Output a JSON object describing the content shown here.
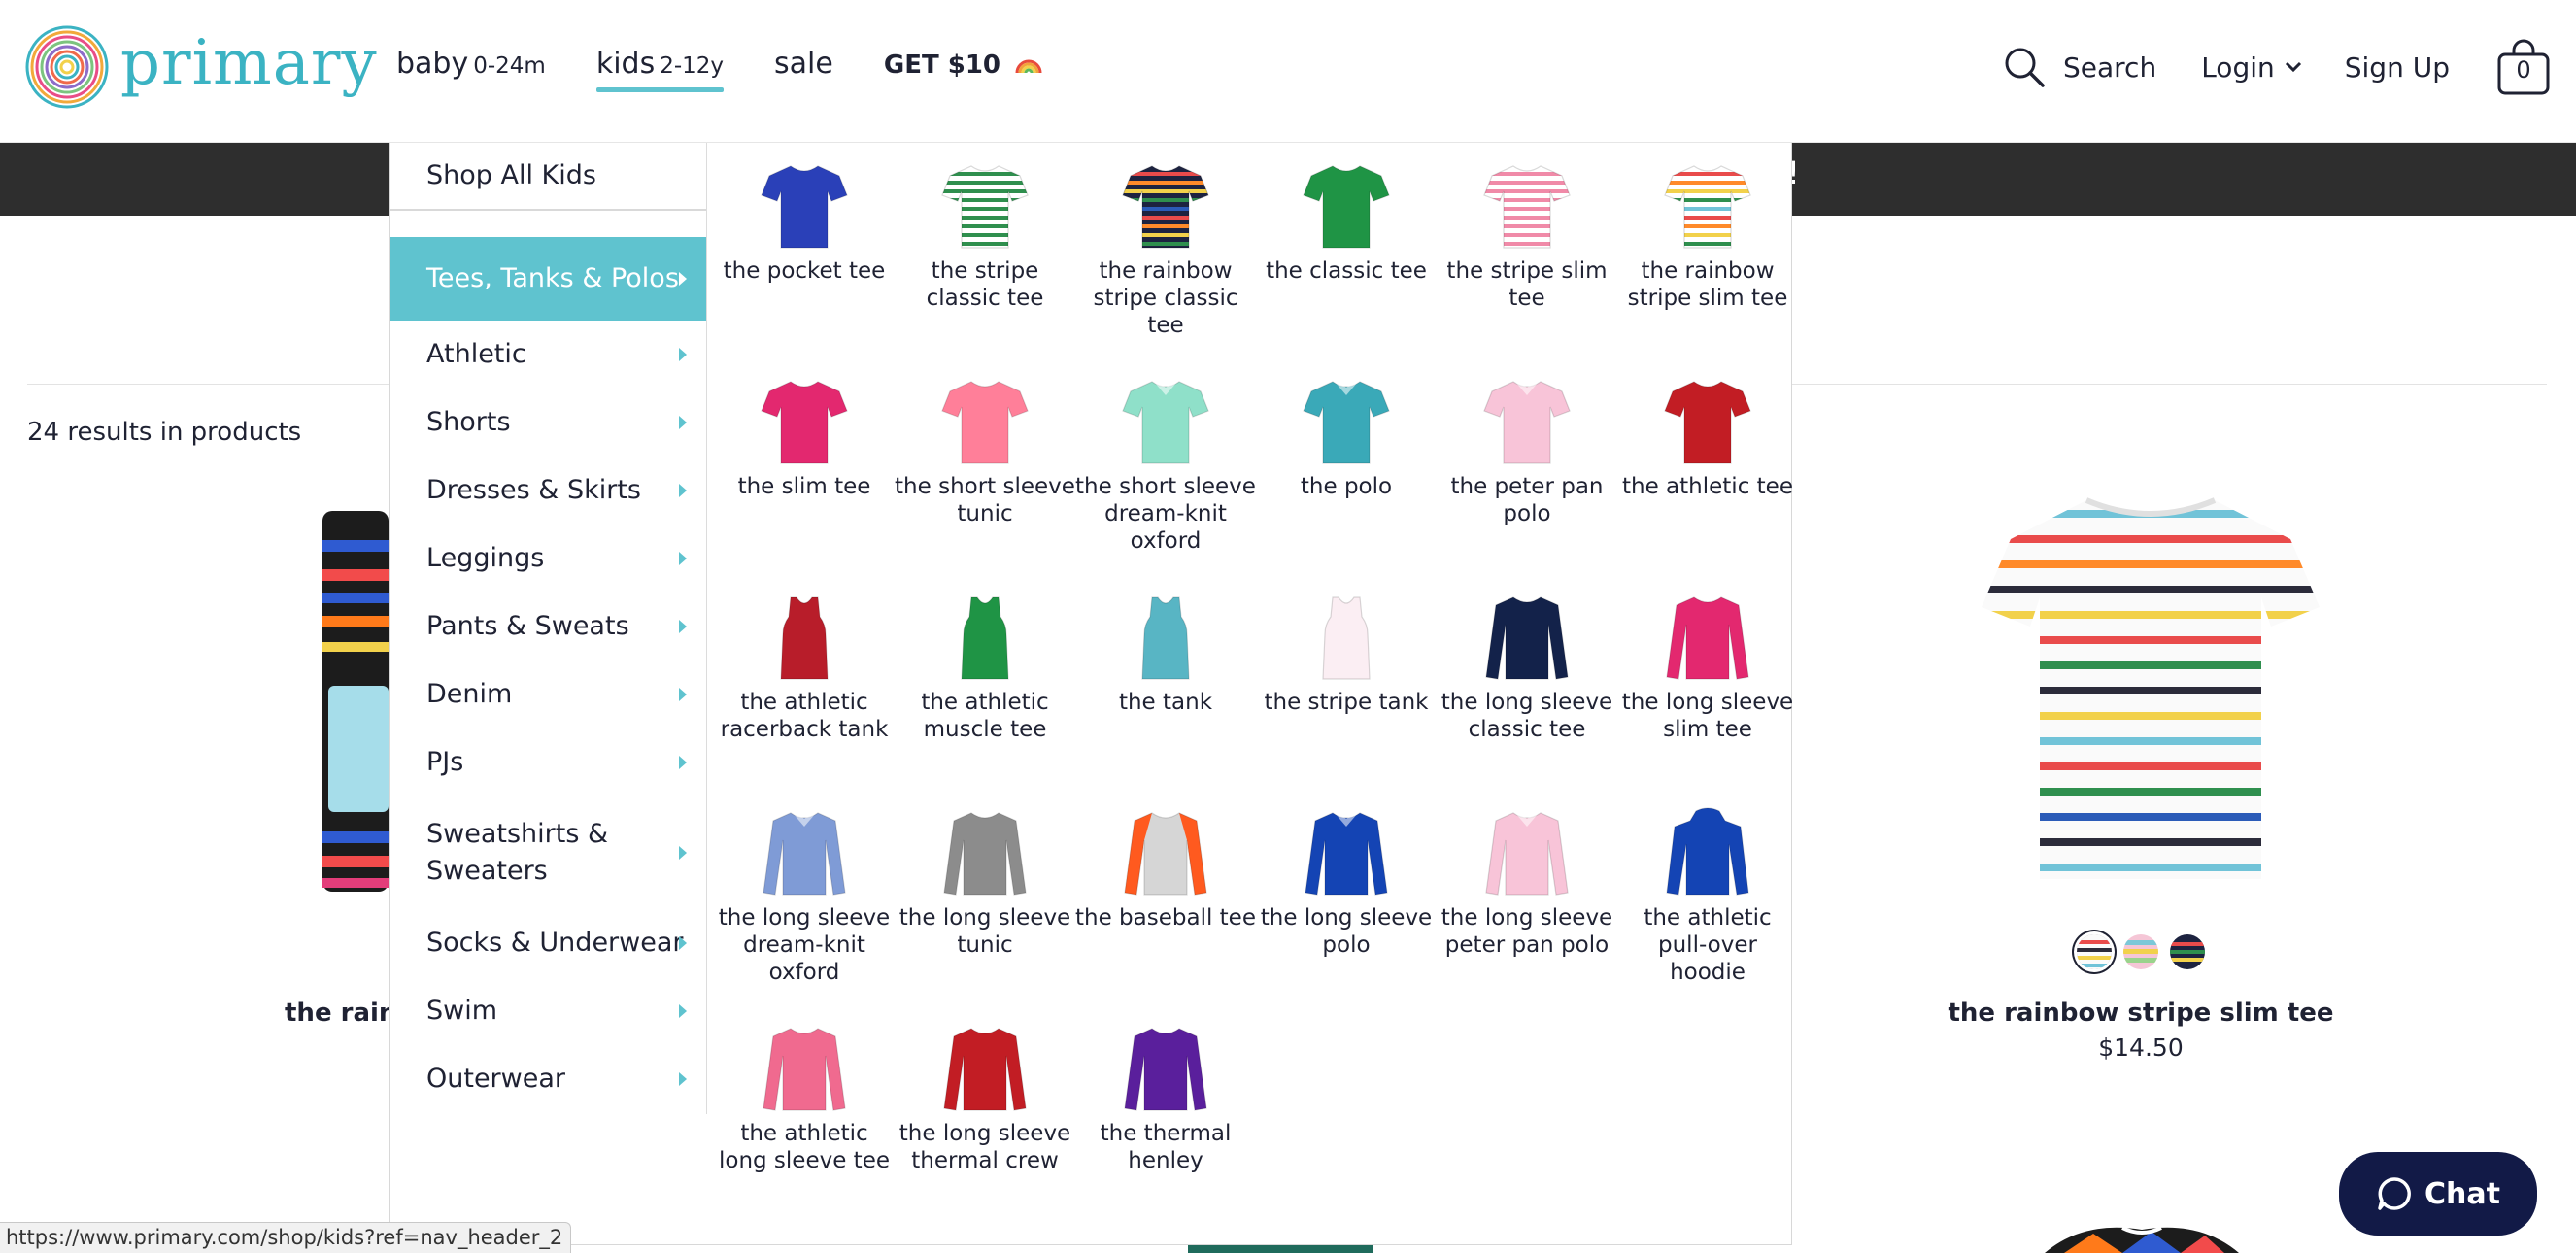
{
  "brand": {
    "name": "primary",
    "color": "#3bb3c3"
  },
  "nav": {
    "items": [
      {
        "label": "baby",
        "age": "0-24m"
      },
      {
        "label": "kids",
        "age": "2-12y"
      },
      {
        "label": "sale",
        "age": ""
      }
    ],
    "promo_label": "GET $10"
  },
  "utility": {
    "search_label": "Search",
    "login_label": "Login",
    "signup_label": "Sign Up",
    "cart_count": "0"
  },
  "promo_bar": {
    "fragment": "!"
  },
  "results_text": "24 results in products",
  "partial_product_title": "the rainb",
  "featured_product": {
    "title": "the rainbow stripe slim tee",
    "price": "$14.50"
  },
  "mega_menu": {
    "shop_all": "Shop All Kids",
    "categories": [
      "Tees, Tanks & Polos",
      "Athletic",
      "Shorts",
      "Dresses & Skirts",
      "Leggings",
      "Pants & Sweats",
      "Denim",
      "PJs",
      "Sweatshirts & Sweaters",
      "Socks & Underwear",
      "Swim",
      "Outerwear"
    ],
    "active_category": "Tees, Tanks & Polos",
    "products": [
      "the pocket tee",
      "the stripe classic tee",
      "the rainbow stripe classic tee",
      "the classic tee",
      "the stripe slim tee",
      "the rainbow stripe slim tee",
      "the slim tee",
      "the short sleeve tunic",
      "the short sleeve dream-knit oxford",
      "the polo",
      "the peter pan polo",
      "the athletic tee",
      "the athletic racerback tank",
      "the athletic muscle tee",
      "the tank",
      "the stripe tank",
      "the long sleeve classic tee",
      "the long sleeve slim tee",
      "the long sleeve dream-knit oxford",
      "the long sleeve tunic",
      "the baseball tee",
      "the long sleeve polo",
      "the long sleeve peter pan polo",
      "the athletic pull-over hoodie",
      "the athletic long sleeve tee",
      "the long sleeve thermal crew",
      "the thermal henley"
    ]
  },
  "status_url": "https://www.primary.com/shop/kids?ref=nav_header_2",
  "chat_label": "Chat",
  "colors": {
    "accent": "#5fc3cf",
    "promo_bar": "#2e2e2e",
    "chat": "#121a47"
  }
}
